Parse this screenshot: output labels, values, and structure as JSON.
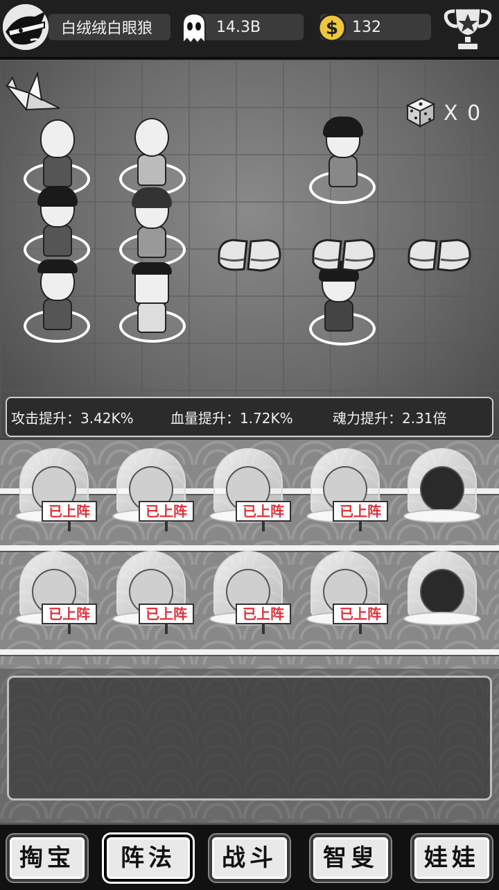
{
  "header": {
    "player_name": "白绒绒白眼狼",
    "souls": "14.3B",
    "coins": "132"
  },
  "board": {
    "dice_count": "X 0",
    "stats": {
      "attack": "攻击提升：3.42K%",
      "hp": "血量提升：1.72K%",
      "soul": "魂力提升：2.31倍"
    }
  },
  "collection": {
    "deployed_label": "已上阵",
    "row1": [
      "deployed",
      "deployed",
      "deployed",
      "deployed",
      "locked"
    ],
    "row2": [
      "deployed",
      "deployed",
      "deployed",
      "deployed",
      "locked"
    ]
  },
  "nav": {
    "tabs": [
      "掏宝",
      "阵法",
      "战斗",
      "智叟",
      "娃娃"
    ],
    "active": "阵法"
  },
  "colors": {
    "sign_text": "#e0303a",
    "background": "#3a3a3a"
  }
}
